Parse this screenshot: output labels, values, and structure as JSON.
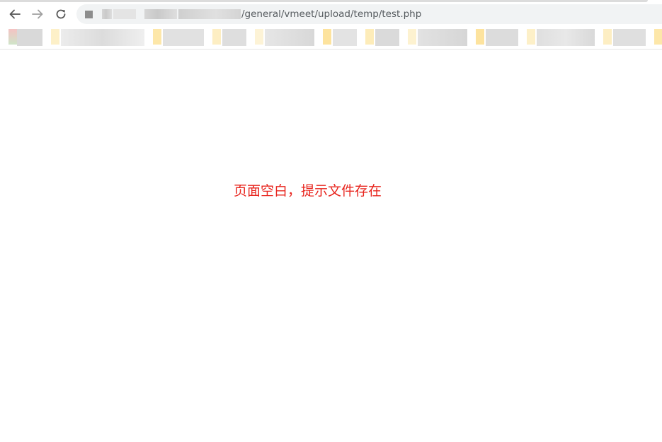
{
  "browser": {
    "url_path": "/general/vmeet/upload/temp/test.php",
    "icons": {
      "back": "arrow-left-icon",
      "forward": "arrow-right-icon",
      "reload": "reload-icon"
    },
    "colors": {
      "address_bar_bg": "#f1f3f4",
      "url_text": "#555a5e",
      "forward_disabled": "#a0a0a0",
      "back": "#555555"
    }
  },
  "page": {
    "message": "页面空白，提示文件存在",
    "message_color": "#e8251e"
  }
}
